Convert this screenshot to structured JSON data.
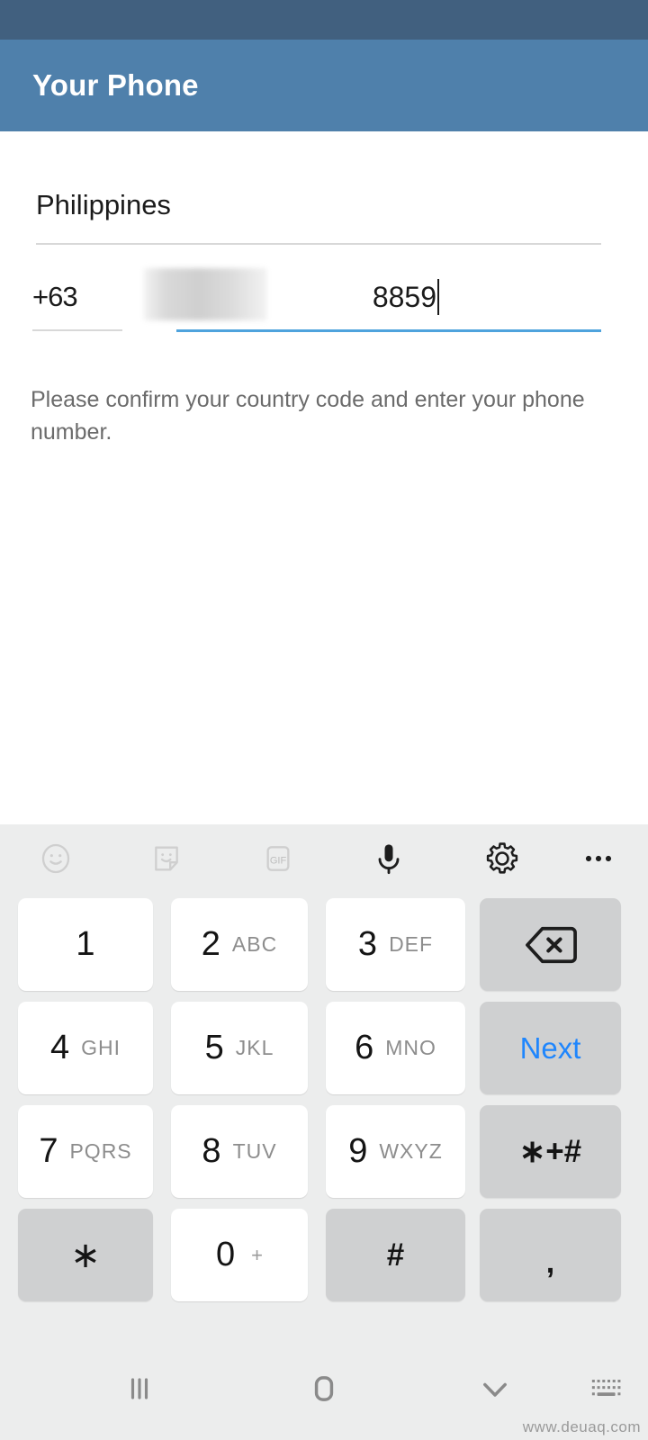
{
  "app": {
    "title": "Your Phone",
    "status_bar_color": "#41607f",
    "app_bar_color": "#4f80ab"
  },
  "form": {
    "country": {
      "label": "country-field",
      "value": "Philippines"
    },
    "country_code": {
      "value": "+63"
    },
    "phone_number": {
      "value": "8859",
      "redacted_prefix": "",
      "focused": true
    },
    "helper_text": "Please confirm your country code and enter your phone number."
  },
  "fab": {
    "icon": "arrow-right-icon",
    "color": "#5ba4dc"
  },
  "annotation": {
    "arrow": "green-pointer-arrow",
    "fill": "#00ee00",
    "stroke": "#000000"
  },
  "keyboard": {
    "background": "#eceded",
    "toolbar": [
      {
        "name": "emoji-icon",
        "label": "emoji"
      },
      {
        "name": "sticker-icon",
        "label": "sticker"
      },
      {
        "name": "gif-icon",
        "label": "GIF"
      },
      {
        "name": "microphone-icon",
        "label": "voice input"
      },
      {
        "name": "settings-gear-icon",
        "label": "settings"
      },
      {
        "name": "overflow-menu-icon",
        "label": "more options"
      }
    ],
    "rows": [
      [
        {
          "main": "1",
          "sub": "",
          "type": "num",
          "name": "key-1"
        },
        {
          "main": "2",
          "sub": "ABC",
          "type": "num",
          "name": "key-2"
        },
        {
          "main": "3",
          "sub": "DEF",
          "type": "num",
          "name": "key-3"
        },
        {
          "main": "",
          "sub": "",
          "type": "backspace",
          "name": "key-backspace"
        }
      ],
      [
        {
          "main": "4",
          "sub": "GHI",
          "type": "num",
          "name": "key-4"
        },
        {
          "main": "5",
          "sub": "JKL",
          "type": "num",
          "name": "key-5"
        },
        {
          "main": "6",
          "sub": "MNO",
          "type": "num",
          "name": "key-6"
        },
        {
          "main": "Next",
          "sub": "",
          "type": "next",
          "name": "key-next"
        }
      ],
      [
        {
          "main": "7",
          "sub": "PQRS",
          "type": "num",
          "name": "key-7"
        },
        {
          "main": "8",
          "sub": "TUV",
          "type": "num",
          "name": "key-8"
        },
        {
          "main": "9",
          "sub": "WXYZ",
          "type": "num",
          "name": "key-9"
        },
        {
          "main": "∗+#",
          "sub": "",
          "type": "sym",
          "name": "key-symbols"
        }
      ],
      [
        {
          "main": "∗",
          "sub": "",
          "type": "star",
          "name": "key-star"
        },
        {
          "main": "0",
          "sub": "+",
          "type": "zero",
          "name": "key-0"
        },
        {
          "main": "#",
          "sub": "",
          "type": "star",
          "name": "key-hash"
        },
        {
          "main": ",",
          "sub": "",
          "type": "comma",
          "name": "key-comma"
        }
      ]
    ],
    "next_key_color": "#1f86fd"
  },
  "nav_bar": [
    {
      "name": "recents-icon",
      "label": "recents"
    },
    {
      "name": "home-icon",
      "label": "home"
    },
    {
      "name": "hide-keyboard-chevron-icon",
      "label": "hide keyboard"
    },
    {
      "name": "keyboard-switcher-icon",
      "label": "change keyboard"
    }
  ],
  "watermark": "www.deuaq.com"
}
